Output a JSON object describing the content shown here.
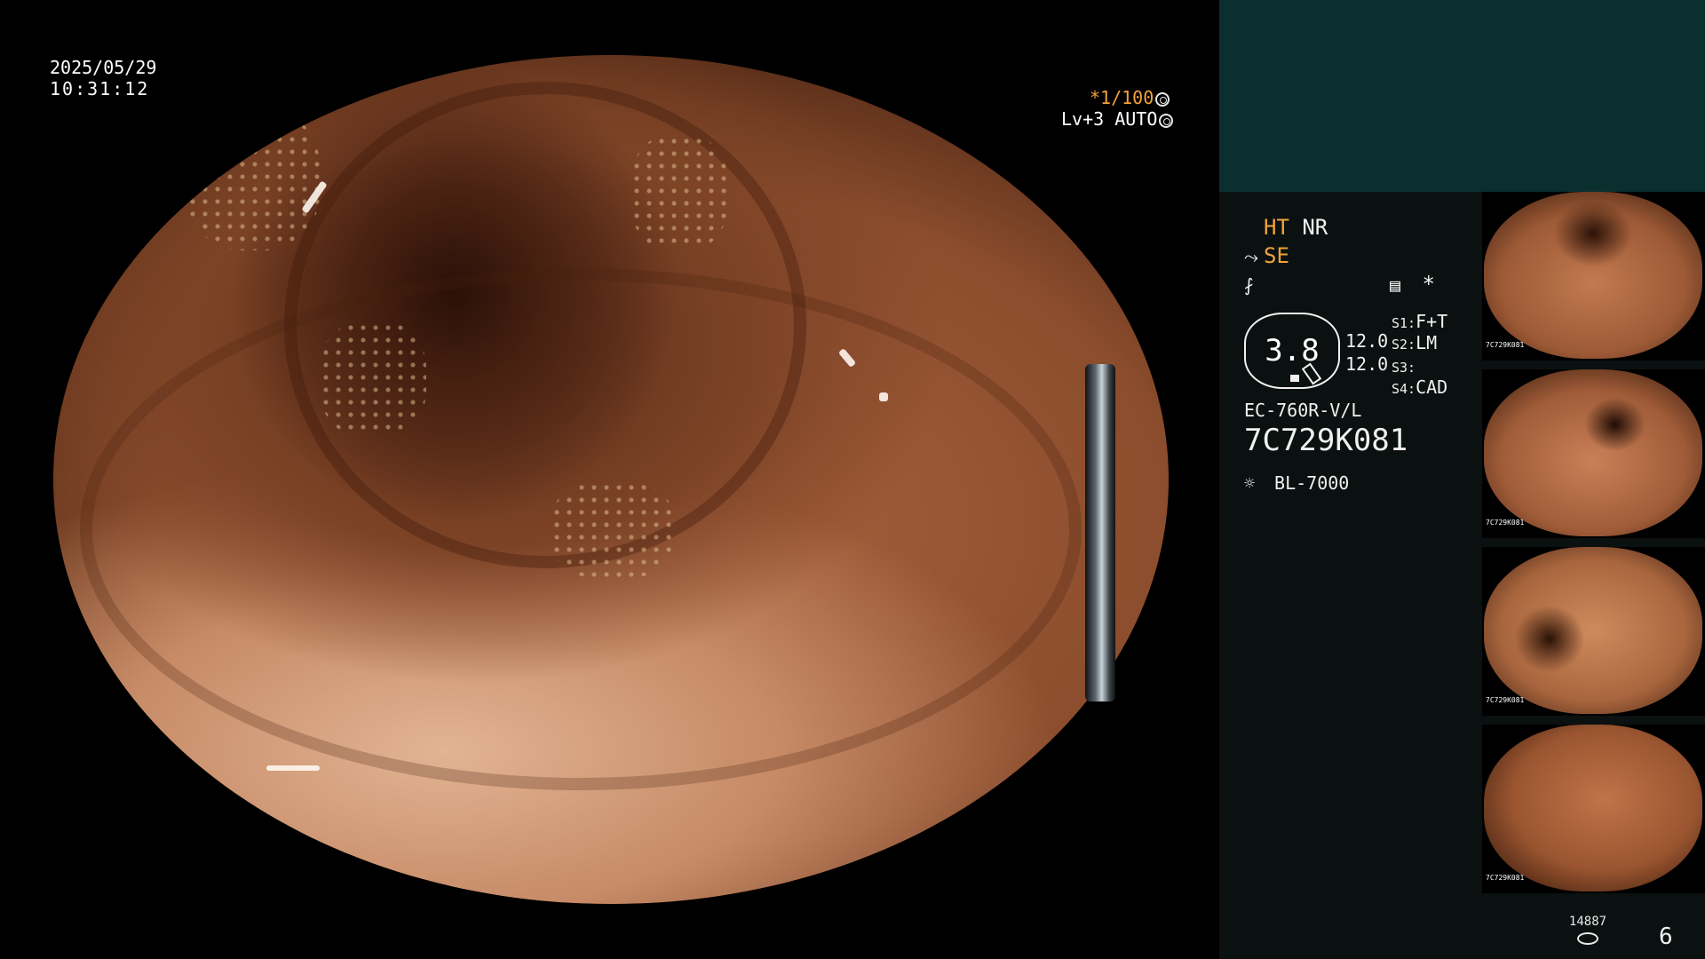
{
  "overlay": {
    "date": "2025/05/29",
    "time": "10:31:12",
    "shutter_star": "*1/100",
    "level": "Lv+3 AUTO"
  },
  "info": {
    "mode_ht": "HT",
    "mode_nr": "NR",
    "mode_se": "SE",
    "gauge_value": "3.8",
    "gauge_val_1": "12.0",
    "gauge_val_2": "12.0",
    "s1_label": "S1:",
    "s1_value": "F+T",
    "s2_label": "S2:",
    "s2_value": "LM",
    "s3_label": "S3:",
    "s3_value": "",
    "s4_label": "S4:",
    "s4_value": "CAD",
    "scope_model": "EC-760R-V/L",
    "serial": "7C729K081",
    "light_source": "BL-7000",
    "star": "*"
  },
  "thumbnails": [
    {
      "id": "7C729K081"
    },
    {
      "id": "7C729K081"
    },
    {
      "id": "7C729K081"
    },
    {
      "id": "7C729K081"
    }
  ],
  "footer": {
    "counter": "14887",
    "page": "6"
  },
  "colors": {
    "accent_orange": "#f3a23a",
    "panel_teal": "#0a2f2e",
    "panel_dark": "#0a1110"
  }
}
